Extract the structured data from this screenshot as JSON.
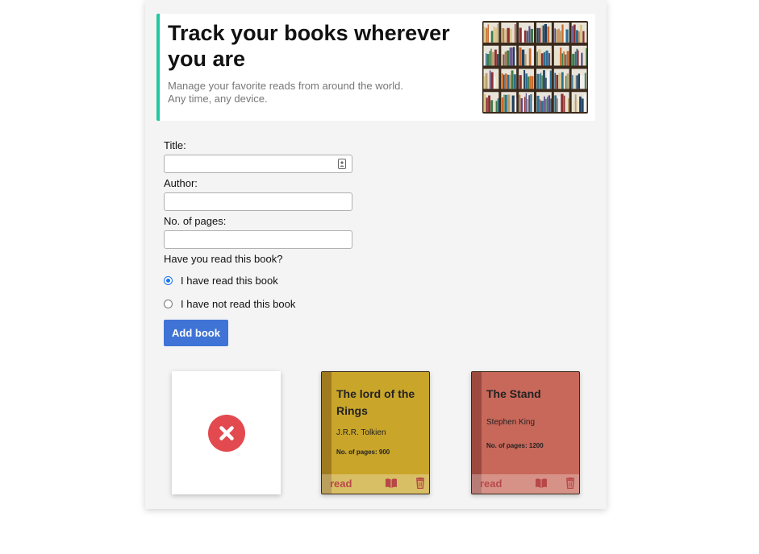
{
  "hero": {
    "title": "Track your books wherever you are",
    "subtitle_line1": "Manage your favorite reads from around the world.",
    "subtitle_line2": "Any time, any device.",
    "image_icon": "bookshelf-image"
  },
  "form": {
    "title_label": "Title:",
    "title_value": "",
    "author_label": "Author:",
    "author_value": "",
    "pages_label": "No. of pages:",
    "pages_value": "",
    "read_question": "Have you read this book?",
    "options": [
      {
        "label": "I have read this book",
        "selected": true
      },
      {
        "label": "I have not read this book",
        "selected": false
      }
    ],
    "submit_label": "Add book"
  },
  "placeholder_card": {
    "icon": "close-icon",
    "color": "#e24a4f"
  },
  "books": [
    {
      "title": "The lord of the Rings",
      "author": "J.R.R. Tolkien",
      "pages": "No. of pages: 900",
      "status": "read",
      "cover_color": "#c9a52a",
      "spine_color": "#a07a1f"
    },
    {
      "title": "The Stand",
      "author": "Stephen King",
      "pages": "No. of pages: 1200",
      "status": "read",
      "cover_color": "#c8685a",
      "spine_color": "#9c4a40"
    }
  ],
  "colors": {
    "accent_border": "#20c9a0",
    "button": "#3f74d6",
    "status_text": "#b84848"
  }
}
